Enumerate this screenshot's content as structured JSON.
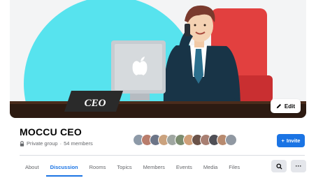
{
  "cover": {
    "desk_sign": "CEO",
    "edit_label": "Edit"
  },
  "group": {
    "name": "MOCCU CEO",
    "privacy": "Private group",
    "separator": "·",
    "members": "54 members"
  },
  "members_avatars": [
    {
      "color": "#8d9aa8"
    },
    {
      "color": "#b97d6c"
    },
    {
      "color": "#6c7588"
    },
    {
      "color": "#caa27e"
    },
    {
      "color": "#9fa6a1"
    },
    {
      "color": "#7c8d70"
    },
    {
      "color": "#d0a07a"
    },
    {
      "color": "#6b5349"
    },
    {
      "color": "#a87f72"
    },
    {
      "color": "#4f4f56"
    },
    {
      "color": "#b78a6f"
    },
    {
      "color": "#9098a2"
    }
  ],
  "invite": {
    "label": "Invite",
    "icon": "plus-icon"
  },
  "tabs": [
    {
      "label": "About",
      "active": false
    },
    {
      "label": "Discussion",
      "active": true
    },
    {
      "label": "Rooms",
      "active": false
    },
    {
      "label": "Topics",
      "active": false
    },
    {
      "label": "Members",
      "active": false
    },
    {
      "label": "Events",
      "active": false
    },
    {
      "label": "Media",
      "active": false
    },
    {
      "label": "Files",
      "active": false
    }
  ],
  "actions": {
    "search_icon": "search-icon",
    "more_icon": "more-options-icon",
    "more_label": "···"
  },
  "colors": {
    "accent": "#1b74e4",
    "cover_circle": "#57e3ee",
    "chair": "#e2403f",
    "suit": "#183447"
  }
}
